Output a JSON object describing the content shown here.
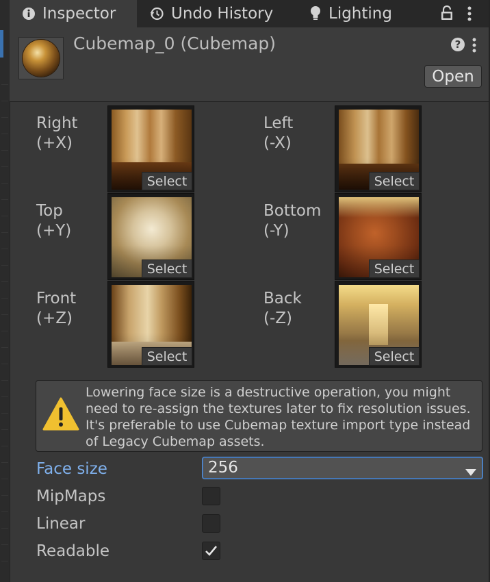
{
  "tabs": [
    {
      "label": "Inspector",
      "icon": "info-icon",
      "active": true
    },
    {
      "label": "Undo History",
      "icon": "history-icon",
      "active": false
    },
    {
      "label": "Lighting",
      "icon": "lightbulb-icon",
      "active": false
    }
  ],
  "header": {
    "title": "Cubemap_0 (Cubemap)",
    "open_label": "Open",
    "thumbnail": "cubemap-sphere-preview"
  },
  "faces": [
    {
      "label": "Right\n(+X)",
      "select_label": "Select"
    },
    {
      "label": "Left\n(-X)",
      "select_label": "Select"
    },
    {
      "label": "Top\n(+Y)",
      "select_label": "Select"
    },
    {
      "label": "Bottom\n(-Y)",
      "select_label": "Select"
    },
    {
      "label": "Front\n(+Z)",
      "select_label": "Select"
    },
    {
      "label": "Back\n(-Z)",
      "select_label": "Select"
    }
  ],
  "warning": {
    "icon": "warning-icon",
    "text": "Lowering face size is a destructive operation, you might need to re-assign the textures later to fix resolution issues. It's preferable to use Cubemap texture import type instead of Legacy Cubemap assets."
  },
  "properties": {
    "face_size": {
      "label": "Face size",
      "value": "256"
    },
    "mipmaps": {
      "label": "MipMaps",
      "checked": false
    },
    "linear": {
      "label": "Linear",
      "checked": false
    },
    "readable": {
      "label": "Readable",
      "checked": true
    }
  },
  "colors": {
    "background": "#383838",
    "accent": "#5b92d6",
    "focused_label": "#7fb0ec",
    "warning": "#f0c030"
  }
}
